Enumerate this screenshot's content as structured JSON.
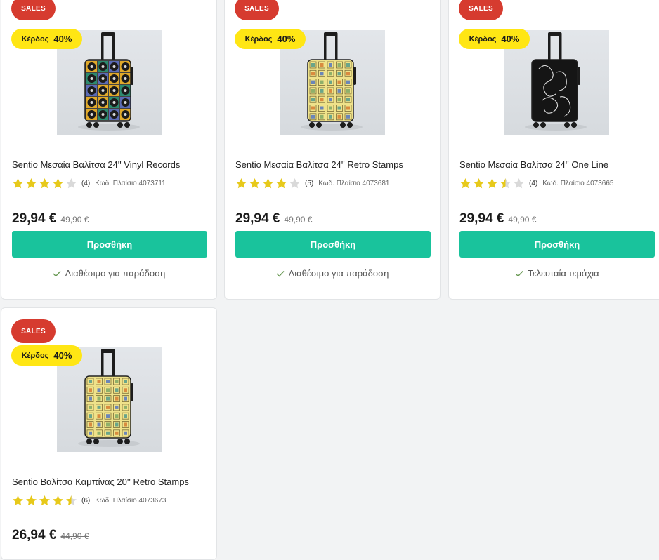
{
  "products": [
    {
      "badge": "SALES",
      "profit_label": "Κέρδος",
      "profit_value": "40%",
      "title": "Sentio Μεσαία Βαλίτσα 24'' Vinyl Records",
      "rating": 4,
      "reviews": "(4)",
      "code": "Κωδ. Πλαίσιο 4073711",
      "price": "29,94 €",
      "old_price": "49,90 €",
      "button": "Προσθήκη",
      "availability": "Διαθέσιμο για παράδοση",
      "suitcase_pattern": "vinyl-records"
    },
    {
      "badge": "SALES",
      "profit_label": "Κέρδος",
      "profit_value": "40%",
      "title": "Sentio Μεσαία Βαλίτσα 24'' Retro Stamps",
      "rating": 4,
      "reviews": "(5)",
      "code": "Κωδ. Πλαίσιο 4073681",
      "price": "29,94 €",
      "old_price": "49,90 €",
      "button": "Προσθήκη",
      "availability": "Διαθέσιμο για παράδοση",
      "suitcase_pattern": "retro-stamps"
    },
    {
      "badge": "SALES",
      "profit_label": "Κέρδος",
      "profit_value": "40%",
      "title": "Sentio Μεσαία Βαλίτσα 24'' One Line",
      "rating": 3.5,
      "reviews": "(4)",
      "code": "Κωδ. Πλαίσιο 4073665",
      "price": "29,94 €",
      "old_price": "49,90 €",
      "button": "Προσθήκη",
      "availability": "Τελευταία τεμάχια",
      "suitcase_pattern": "one-line"
    },
    {
      "badge": "SALES",
      "profit_label": "Κέρδος",
      "profit_value": "40%",
      "title": "Sentio Βαλίτσα Καμπίνας 20'' Retro Stamps",
      "rating": 4.5,
      "reviews": "(6)",
      "code": "Κωδ. Πλαίσιο 4073673",
      "price": "26,94 €",
      "old_price": "44,90 €",
      "suitcase_pattern": "retro-stamps"
    }
  ],
  "colors": {
    "badge_red": "#d63b2f",
    "profit_yellow": "#ffe614",
    "button_green": "#19c39c",
    "star_gold": "#e7c91a",
    "star_empty": "#d9d9d9"
  },
  "icons": {
    "star": "star-icon",
    "availability": "check-icon"
  }
}
